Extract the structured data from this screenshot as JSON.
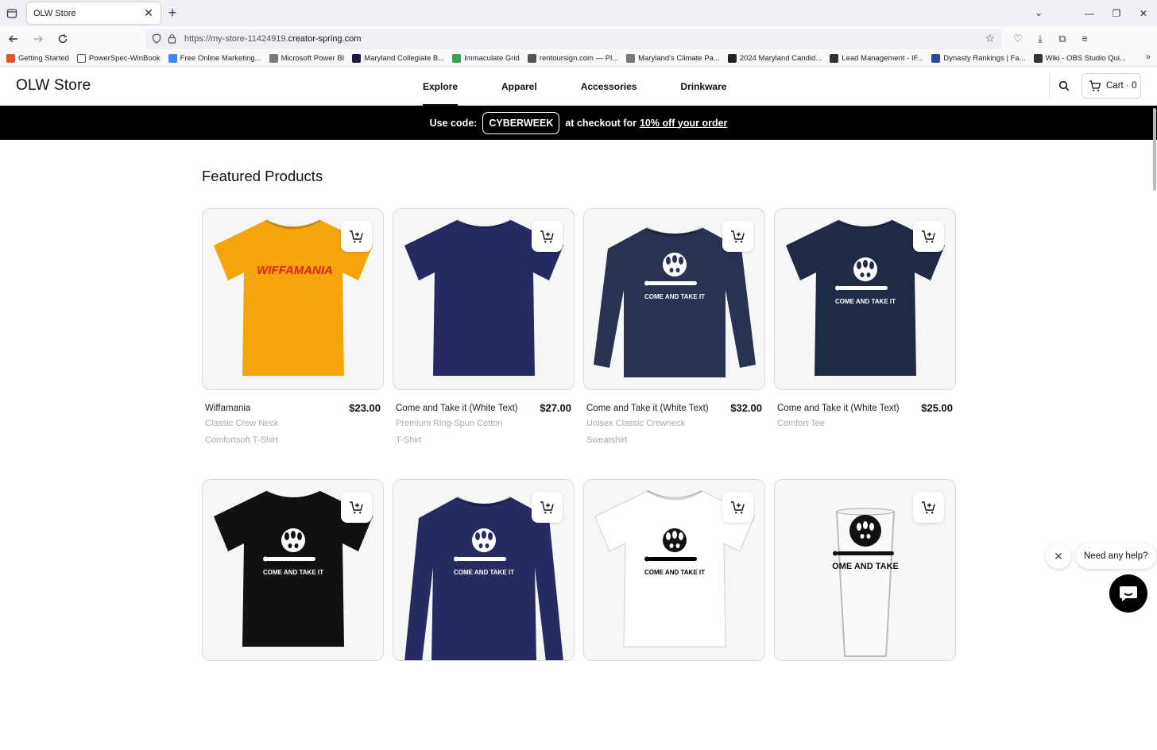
{
  "browser": {
    "tab_title": "OLW Store",
    "url_prefix": "https://my-store-11424919.",
    "url_host": "creator-spring.com",
    "bookmarks": [
      {
        "label": "Getting Started",
        "color": "#e5522e"
      },
      {
        "label": "PowerSpec-WinBook",
        "color": "#ffffff"
      },
      {
        "label": "Free Online Marketing...",
        "color": "#4285f4"
      },
      {
        "label": "Microsoft Power BI",
        "color": "#777777"
      },
      {
        "label": "Maryland Collegiate B...",
        "color": "#1a1a4a"
      },
      {
        "label": "Immaculate Grid",
        "color": "#2eaa4a"
      },
      {
        "label": "rentoursign.com — Pl...",
        "color": "#555555"
      },
      {
        "label": "Maryland's Climate Pa...",
        "color": "#777777"
      },
      {
        "label": "2024 Maryland Candid...",
        "color": "#222222"
      },
      {
        "label": "Lead Management - IF...",
        "color": "#333333"
      },
      {
        "label": "Dynasty Rankings | Fa...",
        "color": "#2a4aa0"
      },
      {
        "label": "Wiki - OBS Studio Qui...",
        "color": "#333333"
      }
    ]
  },
  "site": {
    "brand": "OLW Store",
    "nav": [
      "Explore",
      "Apparel",
      "Accessories",
      "Drinkware"
    ],
    "cart_label": "Cart · 0",
    "promo": {
      "prefix": "Use code:",
      "code": "CYBERWEEK",
      "middle": "at checkout for",
      "link": "10% off your order"
    },
    "section_title": "Featured Products"
  },
  "products": [
    {
      "name": "Wiffamania",
      "sub1": "Classic Crew Neck",
      "sub2": "Comfortsoft T-Shirt",
      "price": "$23.00",
      "art": "WIFFAMANIA",
      "garment": "tshirt",
      "color": "#f5a40c"
    },
    {
      "name": "Come and Take it (White Text)",
      "sub1": "Premium Ring-Spun Cotton",
      "sub2": "T-Shirt",
      "price": "$27.00",
      "art": "",
      "garment": "tshirt",
      "color": "#252a60"
    },
    {
      "name": "Come and Take it (White Text)",
      "sub1": "Unisex Classic Crewneck",
      "sub2": "Sweatshirt",
      "price": "$32.00",
      "art": "COME AND TAKE IT",
      "garment": "sweatshirt",
      "color": "#283352"
    },
    {
      "name": "Come and Take it (White Text)",
      "sub1": "Comfort Tee",
      "sub2": "",
      "price": "$25.00",
      "art": "COME AND TAKE IT",
      "garment": "tshirt",
      "color": "#1f2b45"
    },
    {
      "name": "",
      "sub1": "",
      "sub2": "",
      "price": "",
      "art": "COME AND TAKE IT",
      "garment": "tshirt",
      "color": "#111111"
    },
    {
      "name": "",
      "sub1": "",
      "sub2": "",
      "price": "",
      "art": "COME AND TAKE IT",
      "garment": "longsleeve",
      "color": "#262b62"
    },
    {
      "name": "",
      "sub1": "",
      "sub2": "",
      "price": "",
      "art": "COME AND TAKE IT",
      "garment": "tshirt",
      "color": "#ffffff"
    },
    {
      "name": "",
      "sub1": "",
      "sub2": "",
      "price": "",
      "art": "OME AND TAKE",
      "garment": "glass",
      "color": "#eeeeee"
    }
  ],
  "chat": {
    "prompt": "Need any help?"
  }
}
